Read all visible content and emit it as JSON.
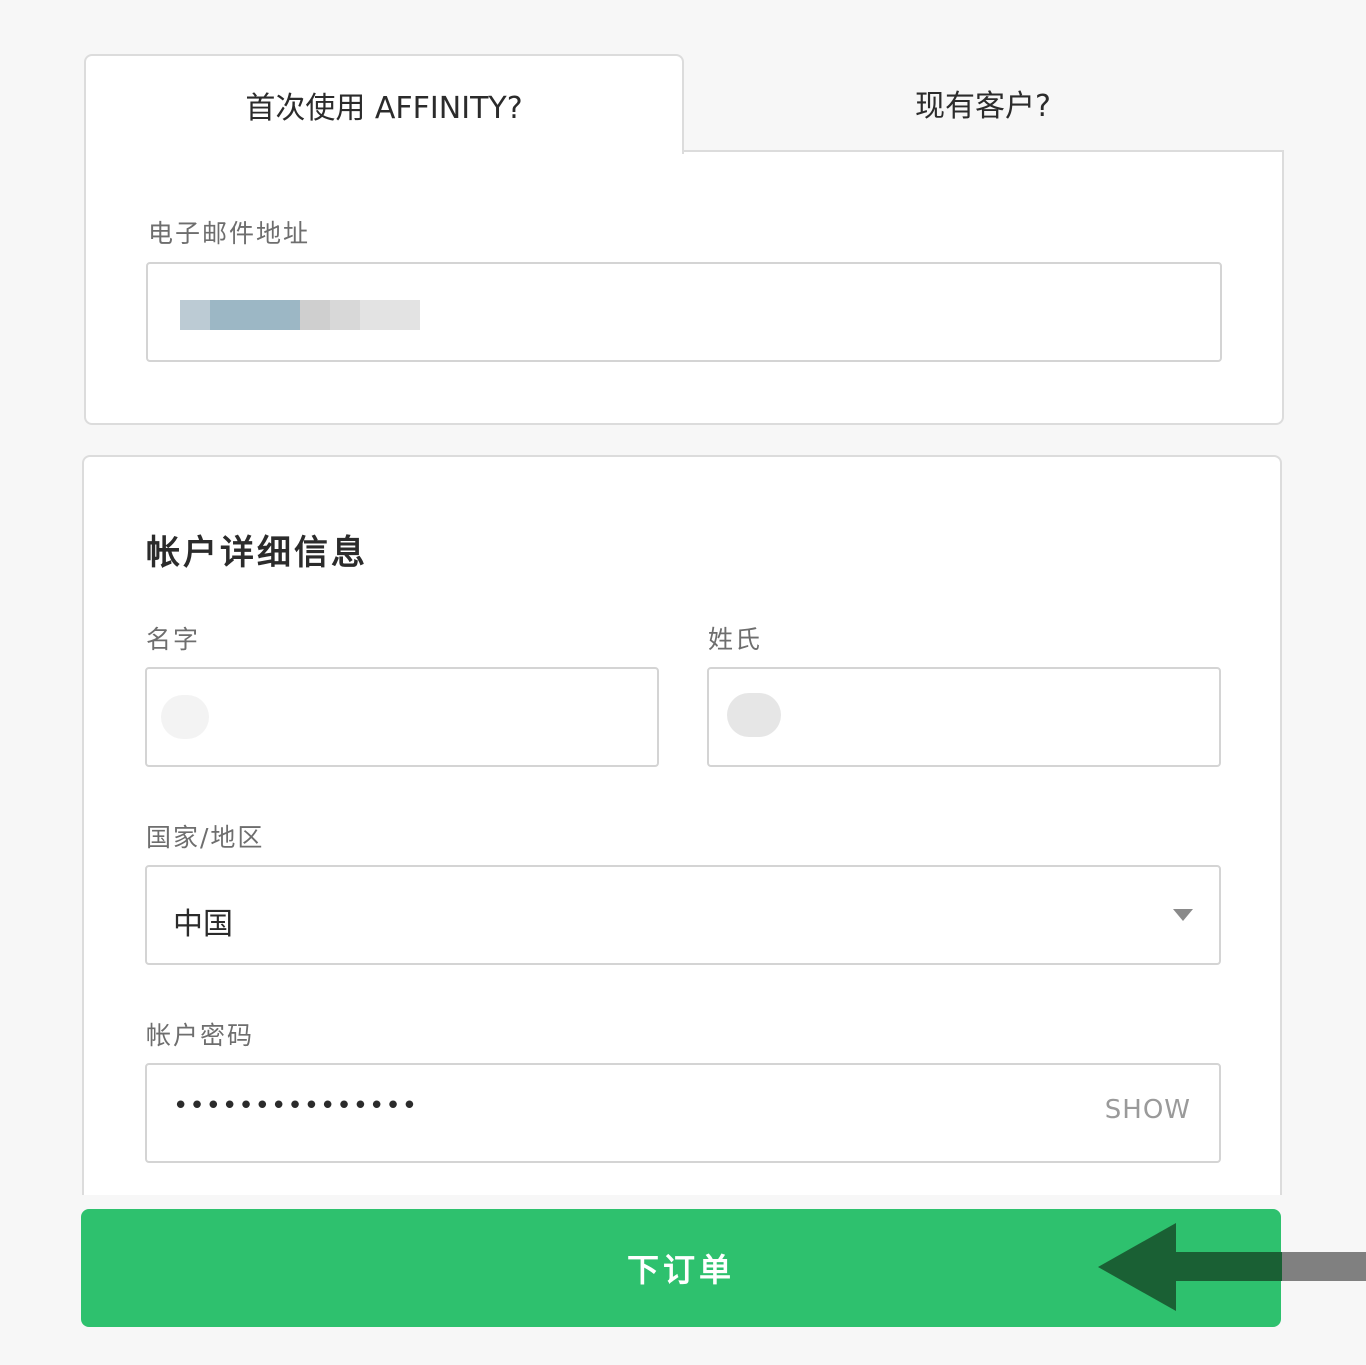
{
  "tabs": {
    "new_customer": "首次使用 AFFINITY?",
    "existing_customer": "现有客户?"
  },
  "email": {
    "label": "电子邮件地址"
  },
  "account": {
    "title": "帐户详细信息",
    "first_name_label": "名字",
    "last_name_label": "姓氏",
    "country_label": "国家/地区",
    "country_value": "中国",
    "password_label": "帐户密码",
    "password_value": "•••••••••••••••",
    "show_label": "SHOW"
  },
  "submit": {
    "label": "下订单"
  },
  "colors": {
    "accent_green": "#2ec16e",
    "arrow_dark": "#1a6034",
    "arrow_grey": "#808080"
  }
}
